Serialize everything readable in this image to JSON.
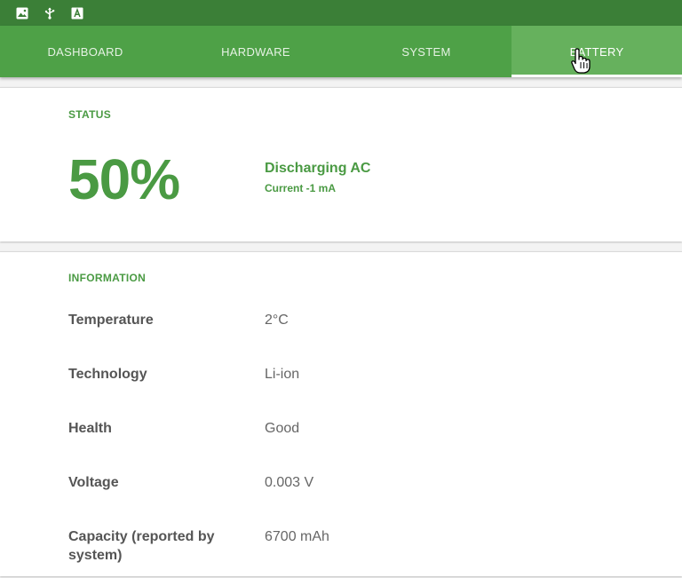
{
  "status_bar": {
    "icons": [
      "image-icon",
      "usb-icon",
      "text-icon"
    ]
  },
  "tabs": [
    {
      "label": "DASHBOARD",
      "active": false
    },
    {
      "label": "HARDWARE",
      "active": false
    },
    {
      "label": "SYSTEM",
      "active": false
    },
    {
      "label": "BATTERY",
      "active": true
    }
  ],
  "status": {
    "title": "STATUS",
    "percent": "50%",
    "state": "Discharging AC",
    "current": "Current -1 mA"
  },
  "information": {
    "title": "INFORMATION",
    "rows": [
      {
        "label": "Temperature",
        "value": "2°C"
      },
      {
        "label": "Technology",
        "value": "Li-ion"
      },
      {
        "label": "Health",
        "value": "Good"
      },
      {
        "label": "Voltage",
        "value": "0.003 V"
      },
      {
        "label": "Capacity (reported by system)",
        "value": "6700 mAh"
      }
    ]
  },
  "colors": {
    "status_bar": "#3b7f37",
    "tab_bar": "#4ea147",
    "active_tab": "#66b15d",
    "accent": "#4a9a43"
  }
}
